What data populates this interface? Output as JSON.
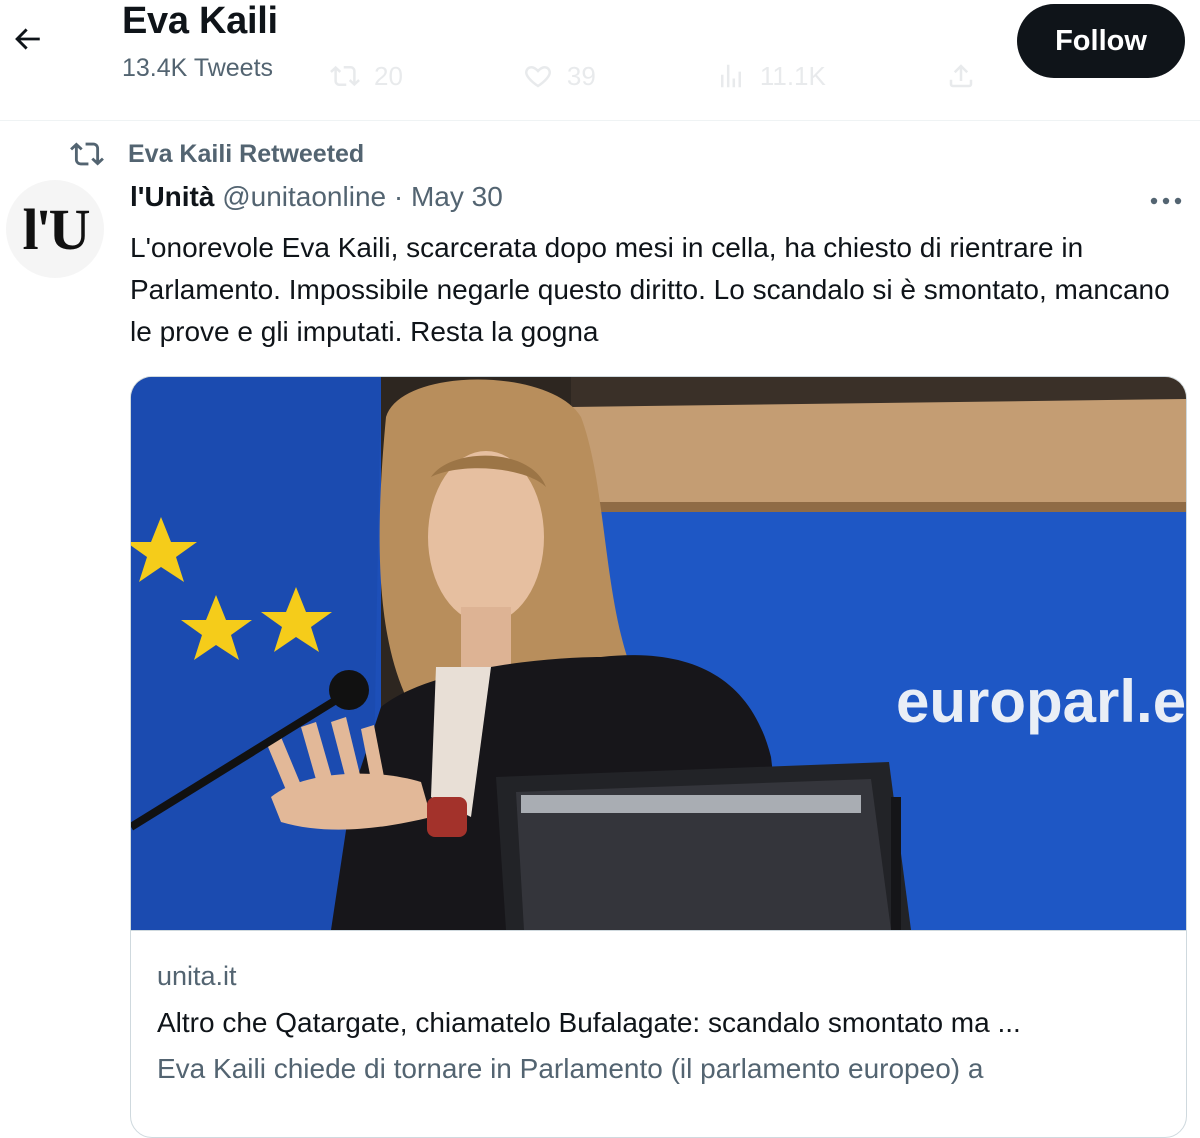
{
  "header": {
    "back_icon": "arrow-left-icon",
    "profile_name": "Eva Kaili",
    "tweet_count": "13.4K Tweets",
    "follow_label": "Follow",
    "ghost_actions": {
      "retweets": "20",
      "likes": "39",
      "views": "11.1K"
    }
  },
  "tweet": {
    "retweet_icon": "retweet-icon",
    "retweeted_by": "Eva Kaili Retweeted",
    "avatar_text": "l'U",
    "author_name": "l'Unità",
    "author_handle": "@unitaonline",
    "separator": "·",
    "date": "May 30",
    "more_icon": "more-dots-icon",
    "text": "L'onorevole Eva Kaili, scarcerata dopo mesi in cella, ha chiesto di rientrare in Parlamento. Impossibile negarle questo diritto. Lo scandalo si è smontato, mancano le prove e gli imputati. Resta la gogna"
  },
  "card": {
    "image_sign_text": "europarl.e",
    "domain": "unita.it",
    "title": "Altro che Qatargate, chiamatelo Bufalagate: scandalo smontato ma ...",
    "description": "Eva Kaili chiede di tornare in Parlamento (il parlamento europeo) a"
  },
  "colors": {
    "text": "#0f1419",
    "muted": "#536471",
    "border": "#cfd9de",
    "follow_bg": "#0f1419",
    "eu_blue": "#1d4fb8",
    "eu_star": "#f5cc1a"
  }
}
